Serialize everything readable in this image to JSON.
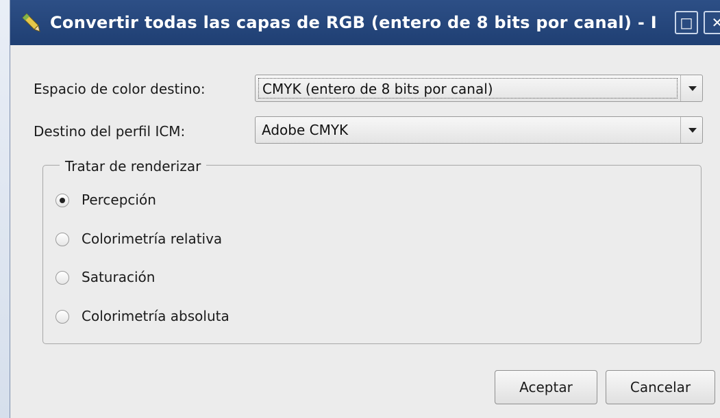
{
  "titlebar": {
    "title": "Convertir todas las capas de RGB (entero de 8 bits por canal) - I",
    "maximize_glyph": "□",
    "close_glyph": "✕",
    "icon": "pencil-app-icon"
  },
  "form": {
    "color_space_label": "Espacio de color destino:",
    "color_space_value": "CMYK (entero de 8 bits por canal)",
    "profile_label": "Destino del perfil ICM:",
    "profile_value": "Adobe CMYK"
  },
  "rendering": {
    "group_title": "Tratar de renderizar",
    "options": [
      {
        "label": "Percepción",
        "checked": true
      },
      {
        "label": "Colorimetría relativa",
        "checked": false
      },
      {
        "label": "Saturación",
        "checked": false
      },
      {
        "label": "Colorimetría absoluta",
        "checked": false
      }
    ]
  },
  "buttons": {
    "ok_label": "Aceptar",
    "cancel_label": "Cancelar"
  },
  "colors": {
    "titlebar": "#1f3f73",
    "window_bg": "#ececec"
  }
}
